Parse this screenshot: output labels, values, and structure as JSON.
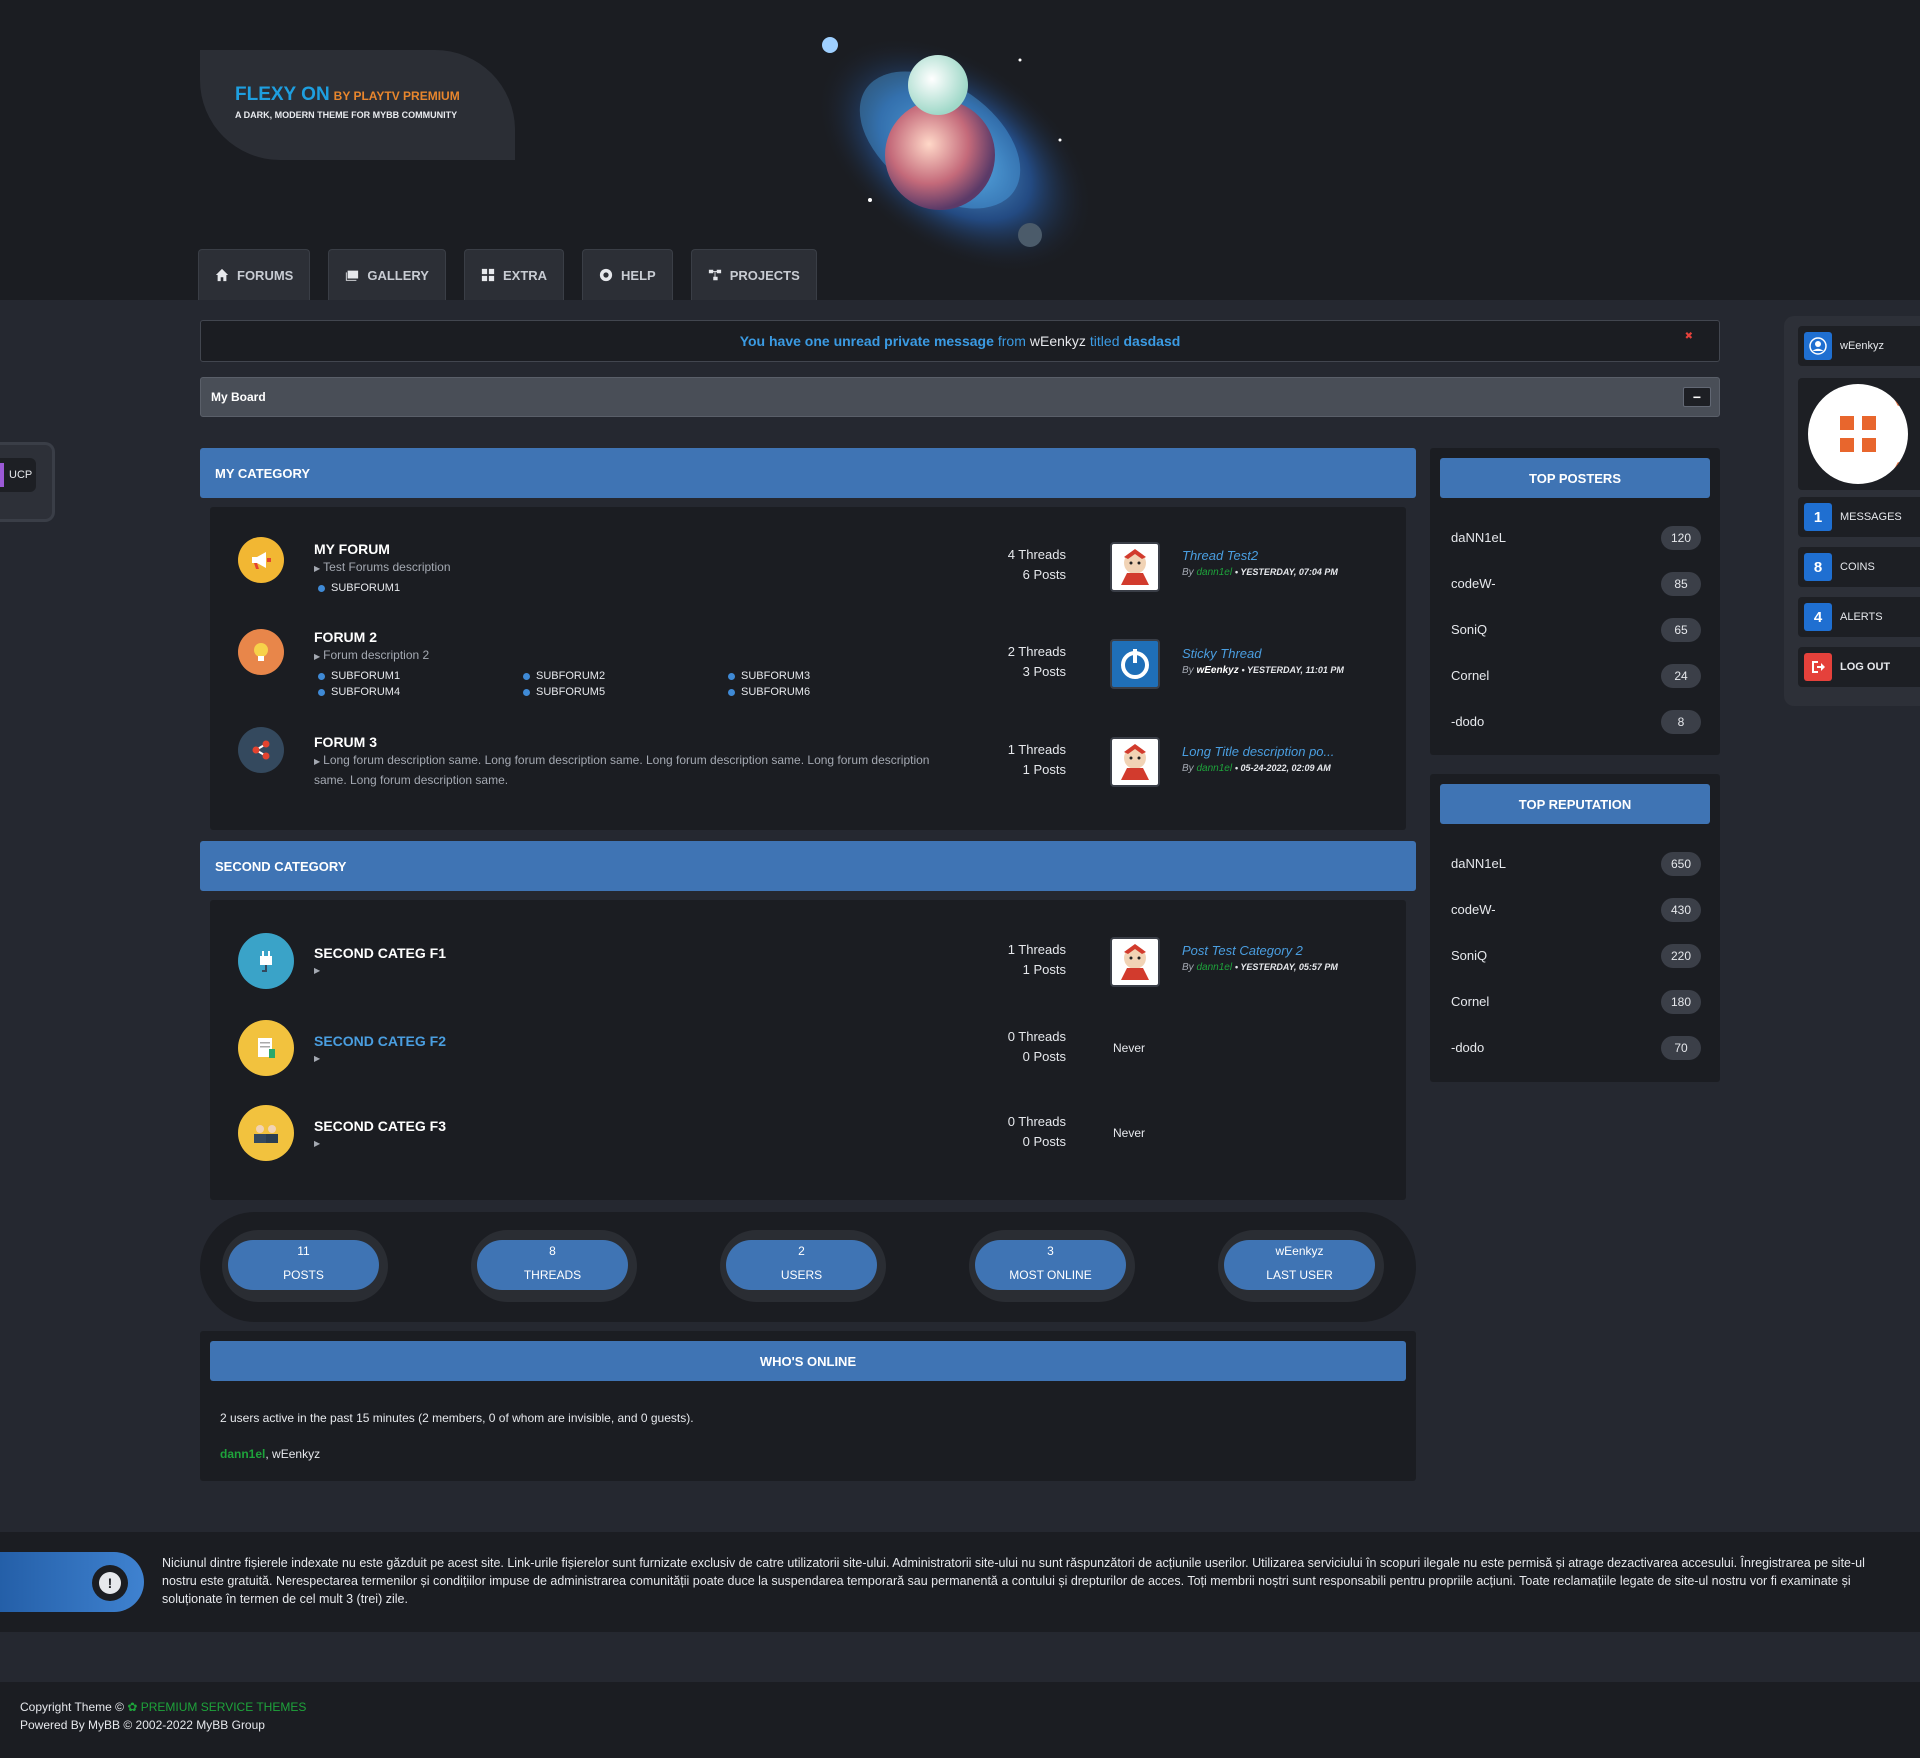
{
  "header": {
    "logo_title": "FLEXY ON",
    "logo_by": "BY PLAYTV PREMIUM",
    "logo_subtitle": "A DARK, MODERN THEME FOR MYBB COMMUNITY"
  },
  "nav": [
    {
      "label": "FORUMS",
      "icon": "home-icon"
    },
    {
      "label": "GALLERY",
      "icon": "images-icon"
    },
    {
      "label": "EXTRA",
      "icon": "grid-icon"
    },
    {
      "label": "HELP",
      "icon": "life-ring-icon"
    },
    {
      "label": "PROJECTS",
      "icon": "sitemap-icon"
    }
  ],
  "ucp": {
    "label": "UCP"
  },
  "pm_notice": {
    "strong": "You have one unread private message",
    "from_word": "from",
    "sender": "wEenkyz",
    "titled_word": "titled",
    "subject": "dasdasd",
    "close": "✖"
  },
  "breadcrumb": {
    "label": "My Board",
    "collapse": "−"
  },
  "categories": [
    {
      "title": "MY CATEGORY",
      "forums": [
        {
          "title": "MY FORUM",
          "desc": "Test Forums description",
          "subforums": [
            "SUBFORUM1"
          ],
          "threads": "4 Threads",
          "posts": "6 Posts",
          "last_title": "Thread Test2",
          "last_by": "By",
          "last_user": "dann1el",
          "last_time": "• YESTERDAY, 07:04 PM"
        },
        {
          "title": "FORUM 2",
          "desc": "Forum description 2",
          "subforums": [
            "SUBFORUM1",
            "SUBFORUM2",
            "SUBFORUM3",
            "SUBFORUM4",
            "SUBFORUM5",
            "SUBFORUM6"
          ],
          "threads": "2 Threads",
          "posts": "3 Posts",
          "last_title": "Sticky Thread",
          "last_by": "By",
          "last_user": "wEenkyz",
          "last_time": "• YESTERDAY, 11:01 PM"
        },
        {
          "title": "FORUM 3",
          "desc": "Long forum description same. Long forum description same. Long forum description same. Long forum description same. Long forum description same.",
          "threads": "1 Threads",
          "posts": "1 Posts",
          "last_title": "Long Title description po...",
          "last_by": "By",
          "last_user": "dann1el",
          "last_time": "• 05-24-2022, 02:09 AM"
        }
      ]
    },
    {
      "title": "SECOND CATEGORY",
      "forums": [
        {
          "title": "SECOND CATEG F1",
          "threads": "1 Threads",
          "posts": "1 Posts",
          "last_title": "Post Test Category 2",
          "last_by": "By",
          "last_user": "dann1el",
          "last_time": "• YESTERDAY, 05:57 PM"
        },
        {
          "title": "SECOND CATEG F2",
          "threads": "0 Threads",
          "posts": "0 Posts",
          "last_never": "Never"
        },
        {
          "title": "SECOND CATEG F3",
          "threads": "0 Threads",
          "posts": "0 Posts",
          "last_never": "Never"
        }
      ]
    }
  ],
  "board_stats": [
    {
      "value": "11",
      "label": "POSTS"
    },
    {
      "value": "8",
      "label": "THREADS"
    },
    {
      "value": "2",
      "label": "USERS"
    },
    {
      "value": "3",
      "label": "MOST ONLINE"
    },
    {
      "value": "wEenkyz",
      "label": "LAST USER"
    }
  ],
  "whos_online": {
    "title": "WHO'S ONLINE",
    "summary": "2 users active in the past 15 minutes (2 members, 0 of whom are invisible, and 0 guests).",
    "user1": "dann1el",
    "sep": ",",
    "user2": "wEenkyz"
  },
  "top_posters": {
    "title": "TOP POSTERS",
    "rows": [
      {
        "name": "daNN1eL",
        "count": "120"
      },
      {
        "name": "codeW-",
        "count": "85"
      },
      {
        "name": "SoniQ",
        "count": "65"
      },
      {
        "name": "Cornel",
        "count": "24"
      },
      {
        "name": "-dodo",
        "count": "8"
      }
    ]
  },
  "top_reputation": {
    "title": "TOP REPUTATION",
    "rows": [
      {
        "name": "daNN1eL",
        "count": "650"
      },
      {
        "name": "codeW-",
        "count": "430"
      },
      {
        "name": "SoniQ",
        "count": "220"
      },
      {
        "name": "Cornel",
        "count": "180"
      },
      {
        "name": "-dodo",
        "count": "70"
      }
    ]
  },
  "user_panel": {
    "username": "wEenkyz",
    "messages_count": "1",
    "messages_label": "MESSAGES",
    "coins_count": "8",
    "coins_label": "COINS",
    "alerts_count": "4",
    "alerts_label": "ALERTS",
    "logout_label": "LOG OUT"
  },
  "footer": {
    "disclaimer": "Niciunul dintre fișierele indexate nu este găzduit pe acest site. Link-urile fișierelor sunt furnizate exclusiv de catre utilizatorii site-ului. Administratorii site-ului nu sunt răspunzători de acțiunile userilor. Utilizarea serviciului în scopuri ilegale nu este permisă și atrage dezactivarea accesului. Înregistrarea pe site-ul nostru este gratuită. Nerespectarea termenilor și condițiilor impuse de administrarea comunității poate duce la suspendarea temporară sau permanentă a contului și drepturilor de acces. Toți membrii noștri sunt responsabili pentru propriile acțiuni. Toate reclamațiile legate de site-ul nostru vor fi examinate și soluționate în termen de cel mult 3 (trei) zile.",
    "copyright_prefix": "Copyright Theme ©",
    "copyright_link": "PREMIUM SERVICE THEMES",
    "powered": "Powered By MyBB © 2002-2022 MyBB Group"
  },
  "colors": {
    "accent": "#3f74b4",
    "link": "#4a9ee0",
    "online_green": "#1ea33b",
    "alert_red": "#e5413b",
    "coins_blue": "#1f6fd1"
  }
}
